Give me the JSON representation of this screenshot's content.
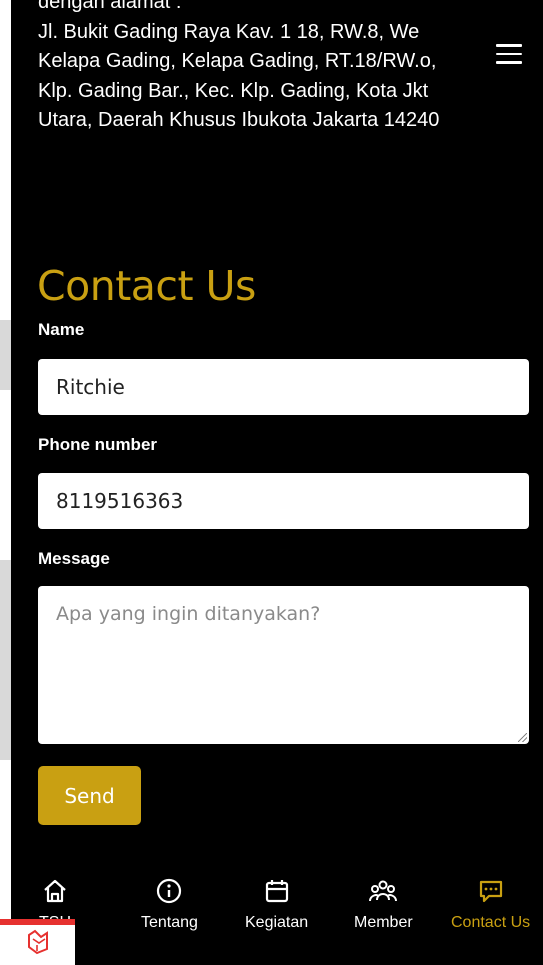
{
  "address": {
    "lines": [
      "dengan alamat :",
      "Jl. Bukit Gading Raya Kav. 1 18, RW.8, We",
      "Kelapa Gading, Kelapa Gading, RT.18/RW.o,",
      "Klp. Gading Bar., Kec. Klp. Gading, Kota Jkt",
      "Utara, Daerah Khusus Ibukota Jakarta 14240"
    ]
  },
  "menu": {
    "icon": "hamburger-icon"
  },
  "contact": {
    "title": "Contact Us",
    "name_label": "Name",
    "name_value": "Ritchie",
    "phone_label": "Phone number",
    "phone_value": "8119516363",
    "message_label": "Message",
    "message_placeholder": "Apa yang ingin ditanyakan?",
    "send_label": "Send"
  },
  "tabs": [
    {
      "label": "TSH",
      "icon": "home-icon"
    },
    {
      "label": "Tentang",
      "icon": "info-icon"
    },
    {
      "label": "Kegiatan",
      "icon": "calendar-icon"
    },
    {
      "label": "Member",
      "icon": "users-icon"
    },
    {
      "label": "Contact Us",
      "icon": "chat-icon",
      "active": true
    }
  ],
  "colors": {
    "background": "#000000",
    "accent": "#c9a012",
    "text": "#ffffff"
  }
}
